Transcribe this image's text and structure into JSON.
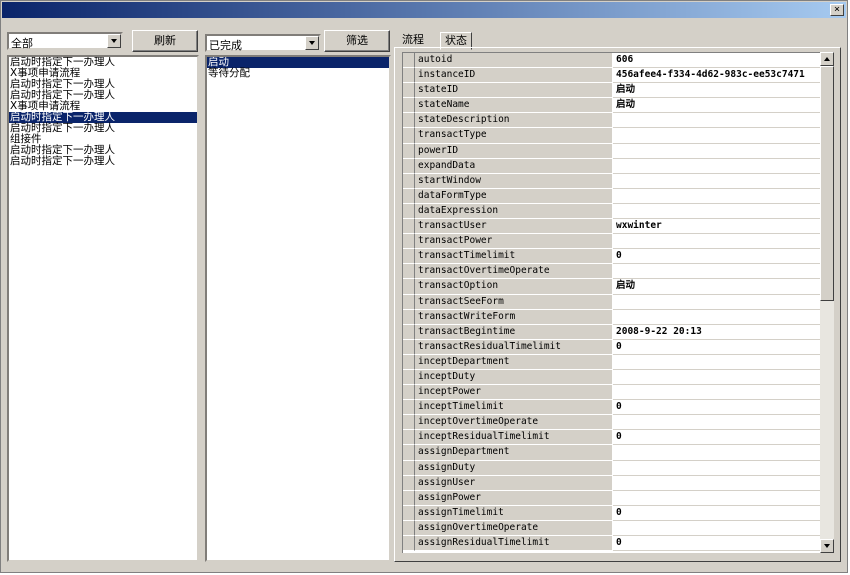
{
  "window": {
    "close_glyph": "×"
  },
  "left_panel": {
    "filter_value": "全部",
    "refresh_label": "刷新",
    "items": [
      "启动时指定下一办理人",
      "X事项申请流程",
      "启动时指定下一办理人",
      "启动时指定下一办理人",
      "X事项申请流程",
      "启动时指定下一办理人",
      "启动时指定下一办理人",
      "组接件",
      "启动时指定下一办理人",
      "启动时指定下一办理人"
    ],
    "selected_index": 5
  },
  "middle_panel": {
    "filter_value": "已完成",
    "filter_button_label": "筛选",
    "items": [
      "启动",
      "等待分配"
    ],
    "selected_index": 0
  },
  "right_panel": {
    "tabs": [
      {
        "label": "流程",
        "active": false
      },
      {
        "label": "状态",
        "active": true
      }
    ],
    "properties": [
      {
        "name": "autoid",
        "value": "606"
      },
      {
        "name": "instanceID",
        "value": "456afee4-f334-4d62-983c-ee53c7471"
      },
      {
        "name": "stateID",
        "value": "启动"
      },
      {
        "name": "stateName",
        "value": "启动"
      },
      {
        "name": "stateDescription",
        "value": ""
      },
      {
        "name": "transactType",
        "value": ""
      },
      {
        "name": "powerID",
        "value": ""
      },
      {
        "name": "expandData",
        "value": ""
      },
      {
        "name": "startWindow",
        "value": ""
      },
      {
        "name": "dataFormType",
        "value": ""
      },
      {
        "name": "dataExpression",
        "value": ""
      },
      {
        "name": "transactUser",
        "value": "wxwinter"
      },
      {
        "name": "transactPower",
        "value": ""
      },
      {
        "name": "transactTimelimit",
        "value": "0"
      },
      {
        "name": "transactOvertimeOperate",
        "value": ""
      },
      {
        "name": "transactOption",
        "value": "启动"
      },
      {
        "name": "transactSeeForm",
        "value": ""
      },
      {
        "name": "transactWriteForm",
        "value": ""
      },
      {
        "name": "transactBegintime",
        "value": "2008-9-22 20:13"
      },
      {
        "name": "transactResidualTimelimit",
        "value": "0"
      },
      {
        "name": "inceptDepartment",
        "value": ""
      },
      {
        "name": "inceptDuty",
        "value": ""
      },
      {
        "name": "inceptPower",
        "value": ""
      },
      {
        "name": "inceptTimelimit",
        "value": "0"
      },
      {
        "name": "inceptOvertimeOperate",
        "value": ""
      },
      {
        "name": "inceptResidualTimelimit",
        "value": "0"
      },
      {
        "name": "assignDepartment",
        "value": ""
      },
      {
        "name": "assignDuty",
        "value": ""
      },
      {
        "name": "assignUser",
        "value": ""
      },
      {
        "name": "assignPower",
        "value": ""
      },
      {
        "name": "assignTimelimit",
        "value": "0"
      },
      {
        "name": "assignOvertimeOperate",
        "value": ""
      },
      {
        "name": "assignResidualTimelimit",
        "value": "0"
      }
    ]
  }
}
